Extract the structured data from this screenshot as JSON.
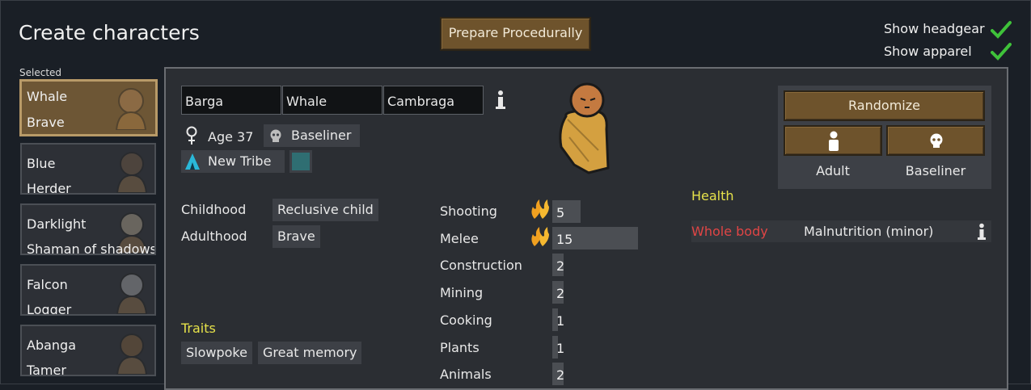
{
  "header": {
    "title": "Create characters",
    "prepare_button": "Prepare Procedurally",
    "toggles": [
      {
        "label": "Show headgear",
        "checked": true
      },
      {
        "label": "Show apparel",
        "checked": true
      }
    ],
    "selected_label": "Selected"
  },
  "pawns": [
    {
      "name": "Whale",
      "title": "Brave",
      "selected": true
    },
    {
      "name": "Blue",
      "title": "Herder",
      "selected": false
    },
    {
      "name": "Darklight",
      "title": "Shaman of shadows",
      "selected": false
    },
    {
      "name": "Falcon",
      "title": "Logger",
      "selected": false
    },
    {
      "name": "Abanga",
      "title": "Tamer",
      "selected": false
    }
  ],
  "character": {
    "first_name": "Barga",
    "nick_name": "Whale",
    "last_name": "Cambraga",
    "age_label": "Age 37",
    "xenotype": "Baseliner",
    "faction": "New Tribe",
    "backstory": {
      "childhood_label": "Childhood",
      "childhood": "Reclusive child",
      "adulthood_label": "Adulthood",
      "adulthood": "Brave"
    },
    "traits_heading": "Traits",
    "traits": [
      "Slowpoke",
      "Great memory"
    ]
  },
  "skills": [
    {
      "name": "Shooting",
      "level": "5",
      "passion": true,
      "fill": 0.25
    },
    {
      "name": "Melee",
      "level": "15",
      "passion": true,
      "fill": 0.75
    },
    {
      "name": "Construction",
      "level": "2",
      "passion": false,
      "fill": 0.1
    },
    {
      "name": "Mining",
      "level": "2",
      "passion": false,
      "fill": 0.1
    },
    {
      "name": "Cooking",
      "level": "1",
      "passion": false,
      "fill": 0.05
    },
    {
      "name": "Plants",
      "level": "1",
      "passion": false,
      "fill": 0.05
    },
    {
      "name": "Animals",
      "level": "2",
      "passion": false,
      "fill": 0.1
    }
  ],
  "randomize": {
    "button": "Randomize",
    "age_option": "Adult",
    "xenotype_option": "Baseliner"
  },
  "health": {
    "heading": "Health",
    "rows": [
      {
        "part": "Whole body",
        "condition": "Malnutrition (minor)"
      }
    ]
  },
  "colors": {
    "wood": "#6e532c",
    "check_green": "#3fc23a",
    "passion_flame": "#f0a020",
    "health_red": "#e04545",
    "heading_yellow": "#e6e24a",
    "faction_color": "#2f6e72",
    "faction_icon": "#2ab8d8"
  }
}
